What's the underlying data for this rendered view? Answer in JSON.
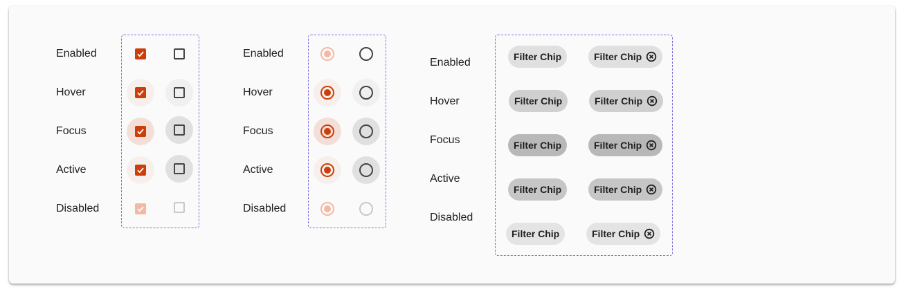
{
  "states": [
    "Enabled",
    "Hover",
    "Focus",
    "Active",
    "Disabled"
  ],
  "checkbox_group": {
    "labels": [
      "Enabled",
      "Hover",
      "Focus",
      "Active",
      "Disabled"
    ]
  },
  "radio_group": {
    "labels": [
      "Enabled",
      "Hover",
      "Focus",
      "Active",
      "Disabled"
    ]
  },
  "chip_group": {
    "labels": [
      "Enabled",
      "Hover",
      "Focus",
      "Active",
      "Disabled"
    ],
    "chip_label": "Filter Chip",
    "remove_icon": "close-circle-icon"
  },
  "colors": {
    "accent": "#cc3f0b",
    "accent_disabled": "#f4b9a3",
    "outline": "#7b6fe0"
  }
}
